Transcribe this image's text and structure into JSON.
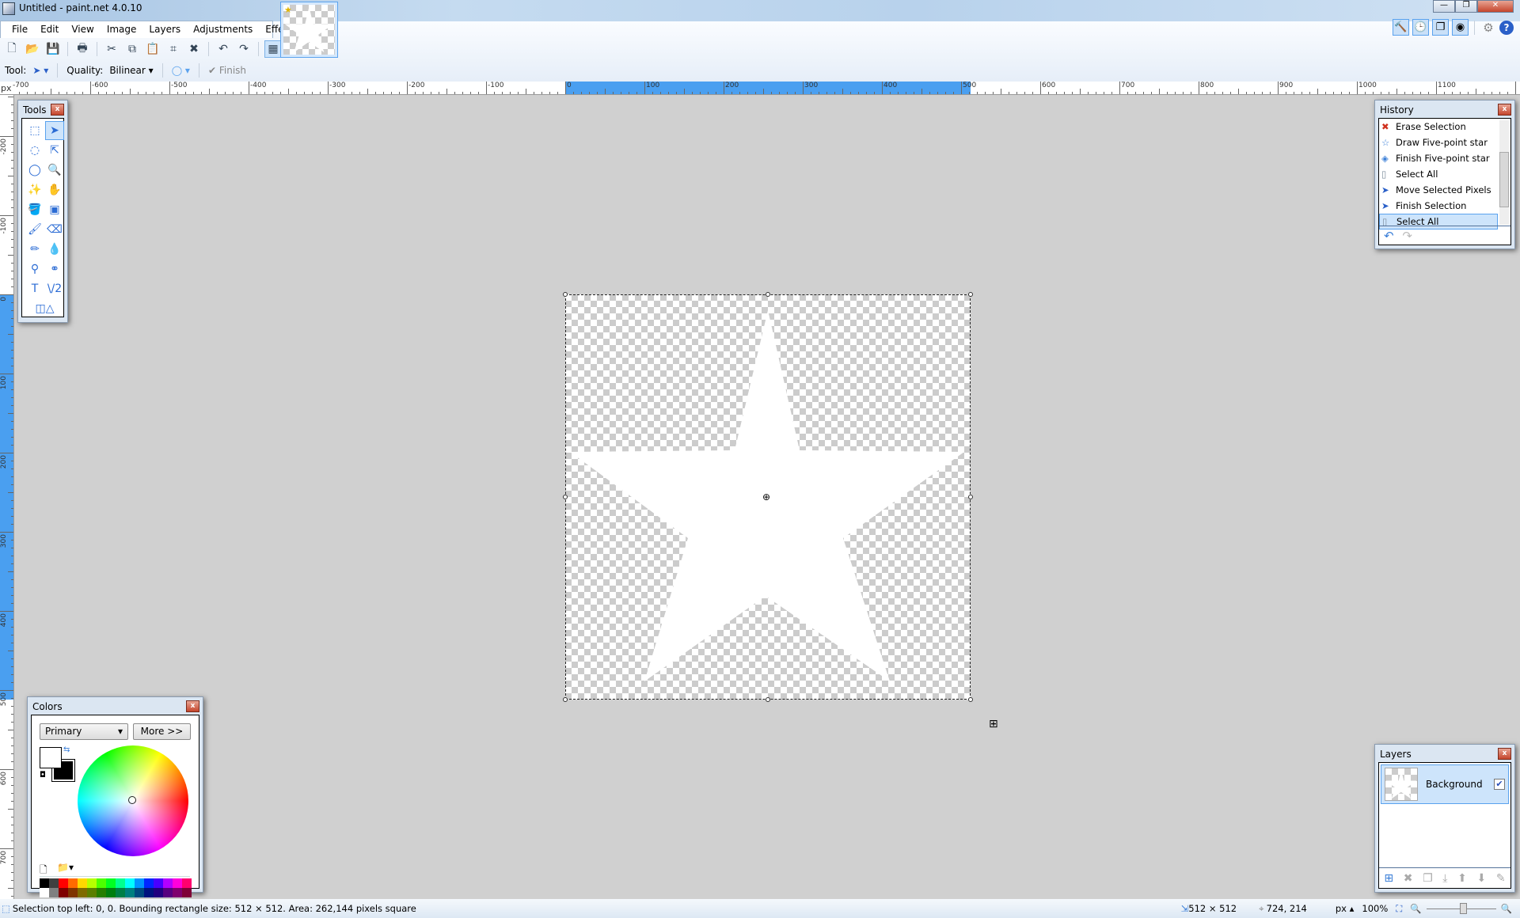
{
  "window": {
    "title": "Untitled - paint.net 4.0.10",
    "minimize": "—",
    "restore": "❐",
    "close": "✕"
  },
  "menu": [
    {
      "label": "File"
    },
    {
      "label": "Edit"
    },
    {
      "label": "View"
    },
    {
      "label": "Image"
    },
    {
      "label": "Layers"
    },
    {
      "label": "Adjustments"
    },
    {
      "label": "Effects"
    }
  ],
  "toolbar": [
    {
      "name": "new-icon",
      "glyph": "🗋"
    },
    {
      "name": "open-icon",
      "glyph": "📂"
    },
    {
      "name": "save-icon",
      "glyph": "💾"
    },
    {
      "sep": true
    },
    {
      "name": "print-icon",
      "glyph": "🖶"
    },
    {
      "sep": true
    },
    {
      "name": "cut-icon",
      "glyph": "✂"
    },
    {
      "name": "copy-icon",
      "glyph": "⧉"
    },
    {
      "name": "paste-icon",
      "glyph": "📋"
    },
    {
      "name": "crop-icon",
      "glyph": "⌗"
    },
    {
      "name": "deselect-icon",
      "glyph": "✖"
    },
    {
      "sep": true
    },
    {
      "name": "undo-icon",
      "glyph": "↶"
    },
    {
      "name": "redo-icon",
      "glyph": "↷"
    },
    {
      "sep": true
    },
    {
      "name": "grid-icon",
      "glyph": "▦",
      "on": true
    },
    {
      "name": "rulers-icon",
      "glyph": "📐",
      "on": true
    }
  ],
  "options": {
    "tool_label": "Tool:",
    "quality_label": "Quality:",
    "quality_value": "Bilinear",
    "finish_label": "Finish"
  },
  "right_tools": [
    {
      "name": "tools-window-icon",
      "glyph": "🔨"
    },
    {
      "name": "history-window-icon",
      "glyph": "🕒"
    },
    {
      "name": "layers-window-icon",
      "glyph": "❐"
    },
    {
      "name": "colors-window-icon",
      "glyph": "◉"
    }
  ],
  "settings_glyph": "⚙",
  "help_glyph": "?",
  "ruler": {
    "unit": "px",
    "h_labels": [
      -700,
      -600,
      -500,
      -400,
      -300,
      -200,
      -100,
      0,
      100,
      200,
      300,
      400,
      500,
      600,
      700,
      800,
      900,
      1000,
      1100
    ],
    "v_labels": [
      -200,
      -100,
      0,
      100,
      200,
      300,
      400,
      500,
      600,
      700
    ],
    "highlight_color": "#4a9ff0"
  },
  "image": {
    "width": 512,
    "height": 512
  },
  "tools_panel": {
    "title": "Tools",
    "items": [
      {
        "name": "rectangle-select-icon",
        "glyph": "⬚"
      },
      {
        "name": "move-selected-pixels-icon",
        "glyph": "➤",
        "on": true
      },
      {
        "name": "lasso-select-icon",
        "glyph": "◌"
      },
      {
        "name": "move-selection-icon",
        "glyph": "⇱"
      },
      {
        "name": "ellipse-select-icon",
        "glyph": "◯"
      },
      {
        "name": "zoom-icon",
        "glyph": "🔍"
      },
      {
        "name": "magic-wand-icon",
        "glyph": "✨"
      },
      {
        "name": "pan-icon",
        "glyph": "✋"
      },
      {
        "name": "paint-bucket-icon",
        "glyph": "🪣"
      },
      {
        "name": "gradient-icon",
        "glyph": "▣"
      },
      {
        "name": "paintbrush-icon",
        "glyph": "🖌"
      },
      {
        "name": "eraser-icon",
        "glyph": "⌫"
      },
      {
        "name": "pencil-icon",
        "glyph": "✏"
      },
      {
        "name": "color-picker-icon",
        "glyph": "💧"
      },
      {
        "name": "clone-stamp-icon",
        "glyph": "⚲"
      },
      {
        "name": "recolor-icon",
        "glyph": "⚭"
      },
      {
        "name": "text-icon",
        "glyph": "T"
      },
      {
        "name": "line-curve-icon",
        "glyph": "\\/2"
      },
      {
        "name": "shapes-icon",
        "glyph": "◫△"
      }
    ]
  },
  "history_panel": {
    "title": "History",
    "items": [
      {
        "label": "Erase Selection",
        "icon": "erase-icon",
        "glyph": "✖",
        "color": "#d0301e"
      },
      {
        "label": "Draw Five-point star",
        "icon": "star-icon",
        "glyph": "☆",
        "color": "#3b7fd8"
      },
      {
        "label": "Finish Five-point star",
        "icon": "shapes-icon",
        "glyph": "◈",
        "color": "#3b7fd8"
      },
      {
        "label": "Select All",
        "icon": "select-all-icon",
        "glyph": "▯",
        "color": "#7a8a9a"
      },
      {
        "label": "Move Selected Pixels",
        "icon": "move-selected-icon",
        "glyph": "➤",
        "color": "#2a5fc8"
      },
      {
        "label": "Finish Selection",
        "icon": "move-selected-icon",
        "glyph": "➤",
        "color": "#2a5fc8"
      },
      {
        "label": "Select All",
        "icon": "select-all-icon",
        "glyph": "▯",
        "color": "#7a8a9a",
        "selected": true
      }
    ],
    "undo": "↶",
    "redo": "↷"
  },
  "layers_panel": {
    "title": "Layers",
    "layers": [
      {
        "name": "Background",
        "visible": true
      }
    ],
    "buttons": [
      {
        "name": "add-layer-icon",
        "glyph": "⊞"
      },
      {
        "name": "delete-layer-icon",
        "glyph": "✖"
      },
      {
        "name": "duplicate-layer-icon",
        "glyph": "❐"
      },
      {
        "name": "merge-down-icon",
        "glyph": "⤓"
      },
      {
        "name": "move-up-icon",
        "glyph": "⬆"
      },
      {
        "name": "move-down-icon",
        "glyph": "⬇"
      },
      {
        "name": "layer-properties-icon",
        "glyph": "✎"
      }
    ]
  },
  "colors_panel": {
    "title": "Colors",
    "mode": "Primary",
    "more_label": "More >>",
    "primary": "#ffffff",
    "secondary": "#000000",
    "palette_top": [
      "#000000",
      "#404040",
      "#ff0000",
      "#ff6a00",
      "#ffd800",
      "#b6ff00",
      "#4cff00",
      "#00ff21",
      "#00ff90",
      "#00ffff",
      "#0094ff",
      "#0026ff",
      "#4800ff",
      "#b200ff",
      "#ff00dc",
      "#ff006e"
    ],
    "palette_bottom": [
      "#ffffff",
      "#808080",
      "#7f0000",
      "#7f3300",
      "#7f6a00",
      "#5b7f00",
      "#267f00",
      "#007f0e",
      "#007f46",
      "#007f7f",
      "#004a7f",
      "#00137f",
      "#21007f",
      "#57007f",
      "#7f006e",
      "#7f0037"
    ]
  },
  "status": {
    "message": "Selection top left: 0, 0. Bounding rectangle size: 512 × 512. Area: 262,144 pixels square",
    "size": "512 × 512",
    "cursor": "724, 214",
    "unit": "px",
    "zoom": "100%"
  }
}
